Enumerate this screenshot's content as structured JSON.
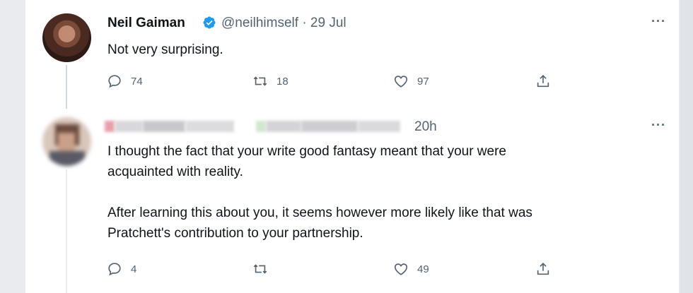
{
  "tweet1": {
    "author_name": "Neil Gaiman",
    "handle_date": "@neilhimself · 29 Jul",
    "text": "Not very surprising.",
    "replies": "74",
    "retweets": "18",
    "likes": "97"
  },
  "tweet2": {
    "time": "20h",
    "text": "I thought the fact that your write good fantasy meant that your were\nacquainted with reality.\n\nAfter learning this about you, it seems however more likely like that was\nPratchett's contribution to your partnership.",
    "replies": "4",
    "retweets": "",
    "likes": "49"
  },
  "more_label": "···",
  "colors": {
    "text": "#0f1419",
    "secondary": "#536471",
    "verified": "#1d9bf0"
  },
  "icons": [
    "reply-icon",
    "retweet-icon",
    "like-icon",
    "share-icon",
    "verified-badge-icon",
    "more-icon"
  ]
}
